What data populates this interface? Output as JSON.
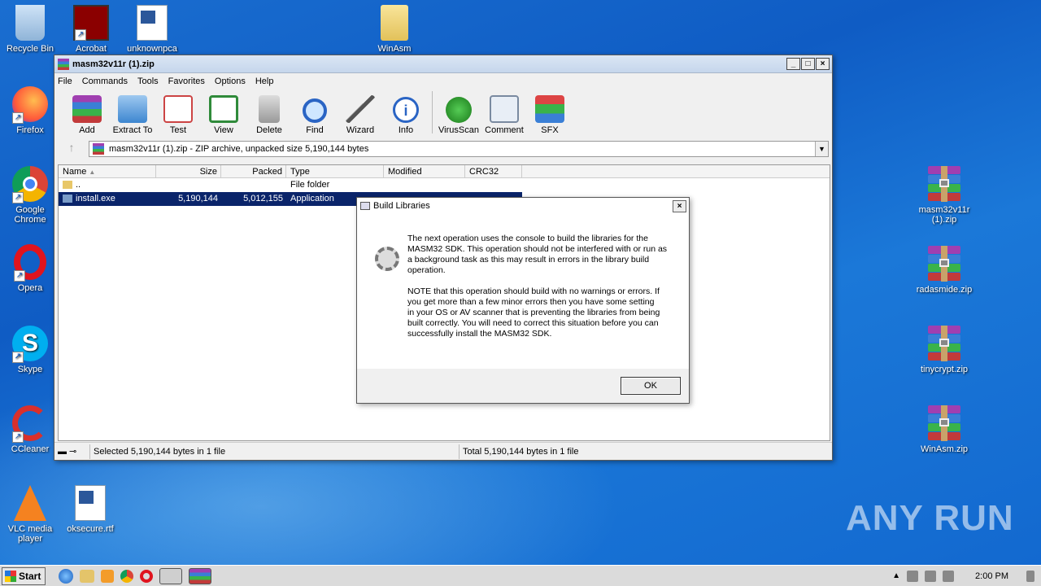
{
  "desktop": {
    "left_icons": [
      {
        "label": "Recycle Bin",
        "icon": "recycle-bin-icon"
      },
      {
        "label": "Acrobat",
        "icon": "acrobat-icon"
      },
      {
        "label": "unknownpca",
        "icon": "word-document-icon"
      },
      {
        "label": "WinAsm",
        "icon": "folder-icon"
      },
      {
        "label": "Firefox",
        "icon": "firefox-icon"
      },
      {
        "label": "Google Chrome",
        "icon": "chrome-icon"
      },
      {
        "label": "Opera",
        "icon": "opera-icon"
      },
      {
        "label": "Skype",
        "icon": "skype-icon"
      },
      {
        "label": "CCleaner",
        "icon": "ccleaner-icon"
      },
      {
        "label": "VLC media player",
        "icon": "vlc-icon"
      },
      {
        "label": "oksecure.rtf",
        "icon": "word-document-icon"
      }
    ],
    "right_icons": [
      {
        "label": "masm32v11r (1).zip"
      },
      {
        "label": "radasmide.zip"
      },
      {
        "label": "tinycrypt.zip"
      },
      {
        "label": "WinAsm.zip"
      }
    ],
    "watermark": "ANY RUN"
  },
  "window": {
    "title": "masm32v11r (1).zip",
    "menu": [
      "File",
      "Commands",
      "Tools",
      "Favorites",
      "Options",
      "Help"
    ],
    "toolbar": [
      "Add",
      "Extract To",
      "Test",
      "View",
      "Delete",
      "Find",
      "Wizard",
      "Info",
      "VirusScan",
      "Comment",
      "SFX"
    ],
    "path": "masm32v11r (1).zip - ZIP archive, unpacked size 5,190,144 bytes",
    "columns": [
      "Name",
      "Size",
      "Packed",
      "Type",
      "Modified",
      "CRC32"
    ],
    "rows": [
      {
        "name": "..",
        "size": "",
        "packed": "",
        "type": "File folder",
        "modified": "",
        "crc": ""
      },
      {
        "name": "install.exe",
        "size": "5,190,144",
        "packed": "5,012,155",
        "type": "Application",
        "modified": "",
        "crc": ""
      }
    ],
    "status_left": "Selected 5,190,144 bytes in 1 file",
    "status_right": "Total 5,190,144 bytes in 1 file"
  },
  "dialog": {
    "title": "Build Libraries",
    "para1": "The next operation uses the console to build the libraries for the MASM32 SDK. This operation should not be interfered with or run as a background task as this may result in errors in the library build operation.",
    "para2": "NOTE that this operation should build with no warnings or errors. If you get more than a few minor errors then you have some setting",
    "para3": "in your OS or AV scanner that is preventing the libraries from being built correctly. You will need to correct this situation before you can successfully install the MASM32 SDK.",
    "ok": "OK"
  },
  "taskbar": {
    "start": "Start",
    "clock": "2:00 PM"
  }
}
